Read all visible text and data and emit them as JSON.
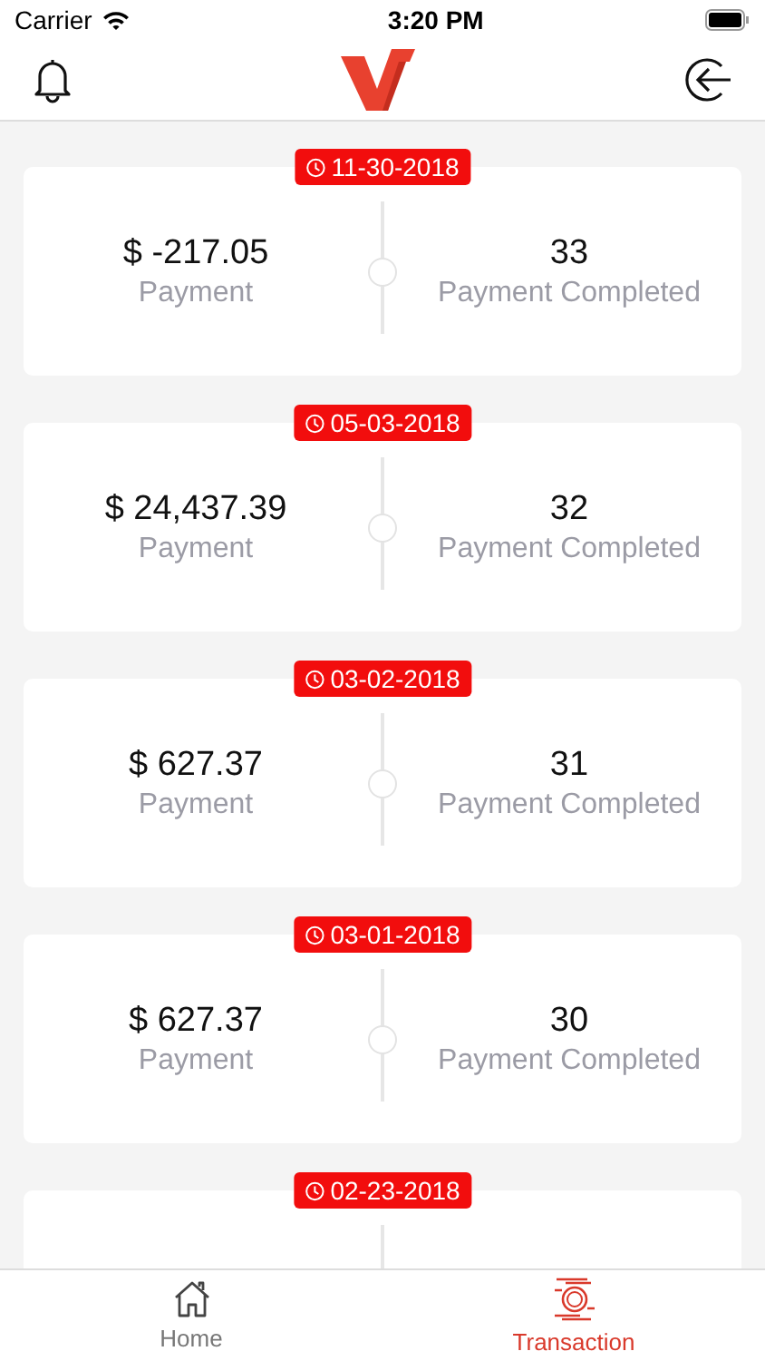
{
  "status_bar": {
    "carrier": "Carrier",
    "time": "3:20 PM"
  },
  "transactions": [
    {
      "date": "11-30-2018",
      "amount": "$ -217.05",
      "amount_label": "Payment",
      "count": "33",
      "count_label": "Payment Completed"
    },
    {
      "date": "05-03-2018",
      "amount": "$ 24,437.39",
      "amount_label": "Payment",
      "count": "32",
      "count_label": "Payment Completed"
    },
    {
      "date": "03-02-2018",
      "amount": "$ 627.37",
      "amount_label": "Payment",
      "count": "31",
      "count_label": "Payment Completed"
    },
    {
      "date": "03-01-2018",
      "amount": "$ 627.37",
      "amount_label": "Payment",
      "count": "30",
      "count_label": "Payment Completed"
    },
    {
      "date": "02-23-2018"
    }
  ],
  "tab_bar": [
    {
      "kind": "home",
      "label": "Home",
      "selected": false
    },
    {
      "kind": "transaction",
      "label": "Transaction",
      "selected": true
    }
  ]
}
